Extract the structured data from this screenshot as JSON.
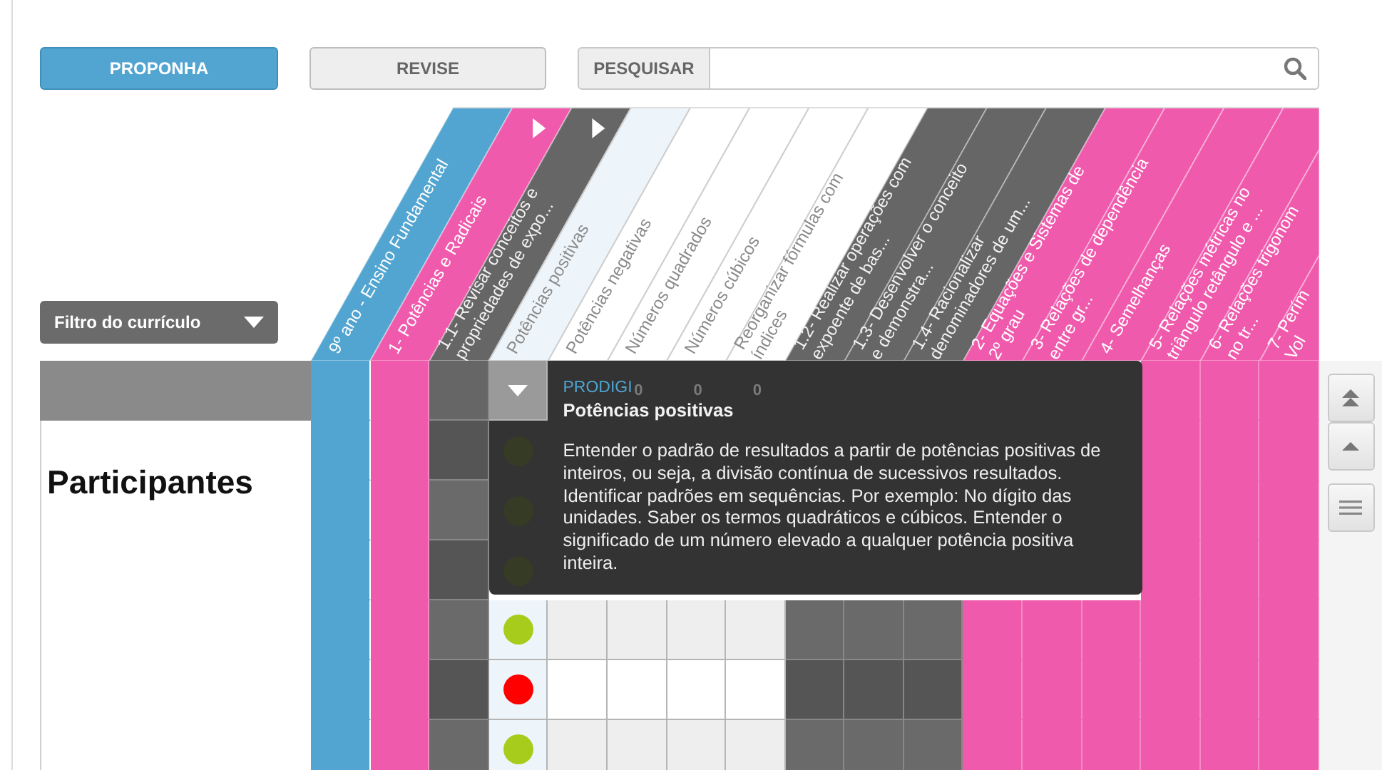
{
  "toolbar": {
    "propose_button": "PROPONHA",
    "review_button": "REVISE",
    "search_button": "PESQUISAR"
  },
  "filter": {
    "label": "Filtro do currículo"
  },
  "participants_label": "Participantes",
  "columns": [
    {
      "kind": "grade",
      "lines": [
        "9º ano - Ensino Fundamental"
      ]
    },
    {
      "kind": "unit",
      "lines": [
        "1- Potências e Radicais"
      ],
      "expanded": true
    },
    {
      "kind": "topic",
      "lines": [
        "1.1- Revisar conceitos e",
        "propriedades de expo..."
      ],
      "expanded": true
    },
    {
      "kind": "skill",
      "lines": [
        "Potências positivas"
      ],
      "selected": true
    },
    {
      "kind": "skill",
      "lines": [
        "Potências negativas"
      ],
      "selected": false
    },
    {
      "kind": "skill",
      "lines": [
        "Números quadrados"
      ],
      "selected": false,
      "count": "0"
    },
    {
      "kind": "skill",
      "lines": [
        "Números cúbicos"
      ],
      "selected": false,
      "count": "0"
    },
    {
      "kind": "skill",
      "lines": [
        "Reorganizar fórmulas com",
        "índices"
      ],
      "selected": false,
      "count": "0"
    },
    {
      "kind": "topic",
      "lines": [
        "1.2- Realizar operações com",
        "expoente de bas..."
      ],
      "expanded": false
    },
    {
      "kind": "topic",
      "lines": [
        "1.3- Desenvolver o conceito",
        "e demonstra..."
      ],
      "expanded": false
    },
    {
      "kind": "topic",
      "lines": [
        "1.4- Racionalizar",
        "denominadores de um..."
      ],
      "expanded": false
    },
    {
      "kind": "unit",
      "lines": [
        "2- Equações e Sistemas de",
        "2º grau"
      ],
      "expanded": false
    },
    {
      "kind": "unit",
      "lines": [
        "3- Relações de dependência",
        "entre gr..."
      ],
      "expanded": false
    },
    {
      "kind": "unit",
      "lines": [
        "4- Semelhanças"
      ],
      "expanded": false
    },
    {
      "kind": "unit",
      "lines": [
        "5- Relações métricas no",
        "triângulo retângulo e ..."
      ],
      "expanded": false
    },
    {
      "kind": "unit",
      "lines": [
        "6- Relações trigonom",
        "no tr..."
      ]
    },
    {
      "kind": "unit",
      "lines": [
        "7- Perím",
        "Vol"
      ]
    }
  ],
  "participants": [
    {
      "color": "#363b25"
    },
    {
      "color": "#363b25"
    },
    {
      "color": "#363b25"
    },
    {
      "color": "#a8cc1c"
    },
    {
      "color": "#ff0000"
    },
    {
      "color": "#a8cc1c"
    }
  ],
  "tooltip": {
    "source": "PRODIGI",
    "title": "Potências positivas",
    "text": "Entender o padrão de resultados a partir de potências positivas de inteiros, ou seja, a divisão contínua de sucessivos resultados. Identificar padrões em sequências. Por exemplo: No dígito das unidades. Saber os termos quadráticos e cúbicos. Entender o significado de um número elevado a qualquer potência positiva inteira."
  }
}
